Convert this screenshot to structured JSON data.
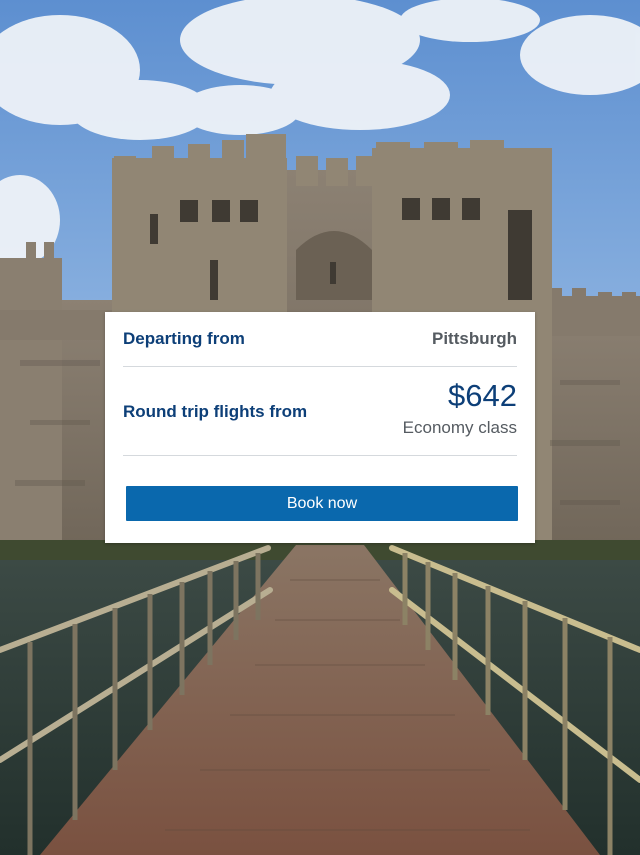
{
  "offer": {
    "departing_label": "Departing from",
    "departing_city": "Pittsburgh",
    "round_trip_label": "Round trip flights from",
    "price": "$642",
    "cabin_class": "Economy class",
    "book_label": "Book now"
  },
  "colors": {
    "heading_blue": "#0d3f78",
    "button_blue": "#0a68ad",
    "muted_gray": "#555b61"
  },
  "background": {
    "subject": "castle-with-wooden-bridge-photo"
  }
}
